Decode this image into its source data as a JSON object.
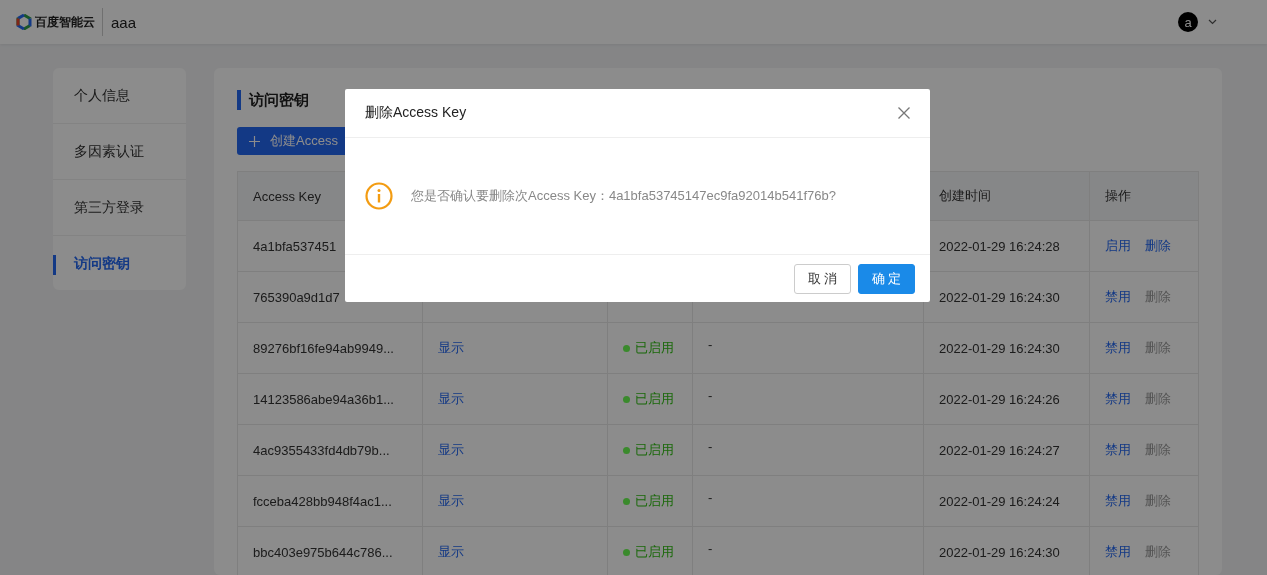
{
  "header": {
    "brand": "百度智能云",
    "account": "aaa",
    "avatar_letter": "a"
  },
  "sidebar": {
    "items": [
      {
        "label": "个人信息",
        "selected": false
      },
      {
        "label": "多因素认证",
        "selected": false
      },
      {
        "label": "第三方登录",
        "selected": false
      },
      {
        "label": "访问密钥",
        "selected": true
      }
    ]
  },
  "content": {
    "title": "访问密钥",
    "create_button": "创建Access",
    "table": {
      "header": {
        "access_key": "Access Key",
        "created": "创建时间",
        "actions": "操作"
      },
      "rows": [
        {
          "access_key": "4a1bfa537451",
          "created": "2022-01-29 16:24:28",
          "actions": [
            {
              "label": "启用",
              "disabled": false
            },
            {
              "label": "删除",
              "disabled": false
            }
          ]
        },
        {
          "access_key": "765390a9d1d7",
          "created": "2022-01-29 16:24:30",
          "actions": [
            {
              "label": "禁用",
              "disabled": false
            },
            {
              "label": "删除",
              "disabled": true
            }
          ]
        },
        {
          "access_key": "89276bf16fe94ab9949...",
          "secret": "显示",
          "status": {
            "label": "已启用",
            "color": "#3a8a2c"
          },
          "description": "-",
          "created": "2022-01-29 16:24:30",
          "actions": [
            {
              "label": "禁用",
              "disabled": false
            },
            {
              "label": "删除",
              "disabled": true
            }
          ]
        },
        {
          "access_key": "14123586abe94a36b1...",
          "secret": "显示",
          "status": {
            "label": "已启用",
            "color": "#3a8a2c"
          },
          "description": "-",
          "created": "2022-01-29 16:24:26",
          "actions": [
            {
              "label": "禁用",
              "disabled": false
            },
            {
              "label": "删除",
              "disabled": true
            }
          ]
        },
        {
          "access_key": "4ac9355433fd4db79b...",
          "secret": "显示",
          "status": {
            "label": "已启用",
            "color": "#3a8a2c"
          },
          "description": "-",
          "created": "2022-01-29 16:24:27",
          "actions": [
            {
              "label": "禁用",
              "disabled": false
            },
            {
              "label": "删除",
              "disabled": true
            }
          ]
        },
        {
          "access_key": "fcceba428bb948f4ac1...",
          "secret": "显示",
          "status": {
            "label": "已启用",
            "color": "#3a8a2c"
          },
          "description": "-",
          "created": "2022-01-29 16:24:24",
          "actions": [
            {
              "label": "禁用",
              "disabled": false
            },
            {
              "label": "删除",
              "disabled": true
            }
          ]
        },
        {
          "access_key": "bbc403e975b644c786...",
          "secret": "显示",
          "status": {
            "label": "已启用",
            "color": "#3a8a2c"
          },
          "description": "-",
          "created": "2022-01-29 16:24:30",
          "actions": [
            {
              "label": "禁用",
              "disabled": false
            },
            {
              "label": "删除",
              "disabled": true
            }
          ]
        }
      ]
    }
  },
  "dialog": {
    "title": "删除Access Key",
    "message": "您是否确认要删除次Access Key：4a1bfa53745147ec9fa92014b541f76b?",
    "buttons": [
      {
        "label": "取 消",
        "kind": "secondary"
      },
      {
        "label": "确 定",
        "kind": "primary"
      }
    ]
  }
}
